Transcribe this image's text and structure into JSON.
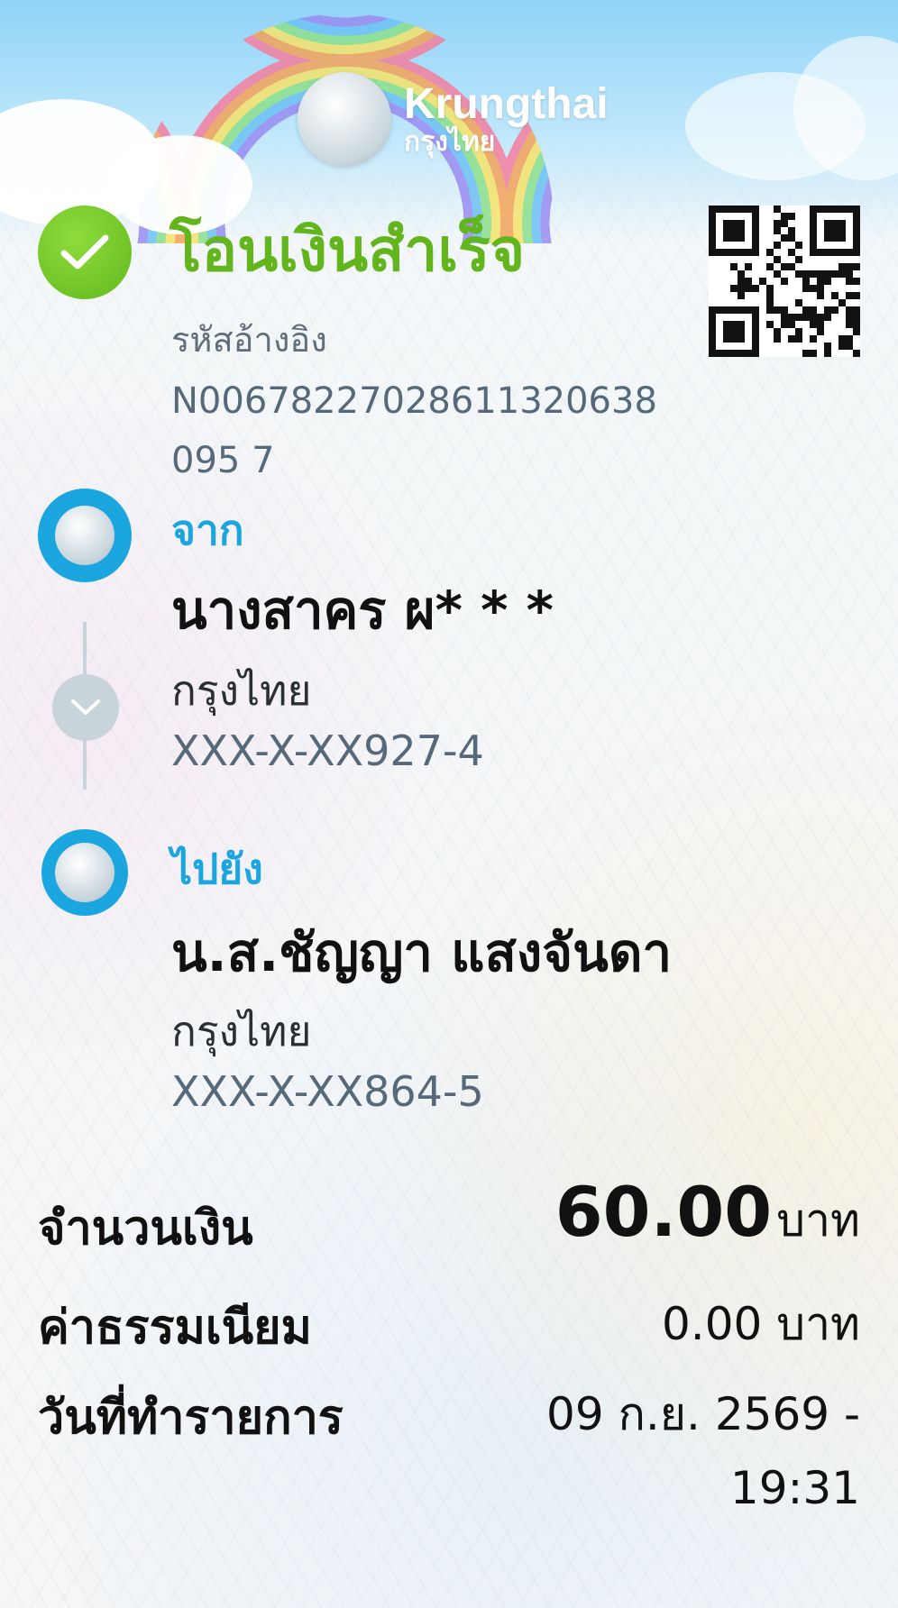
{
  "brand": {
    "name_en": "Krungthai",
    "name_th": "กรุงไทย"
  },
  "status": {
    "title": "โอนเงินสำเร็จ",
    "icon": "check-icon",
    "color": "#63b51e"
  },
  "reference": {
    "label": "รหัสอ้างอิง",
    "value": "N00678227028611320638095 7"
  },
  "from": {
    "label": "จาก",
    "name": "นางสาคร ผ* * *",
    "bank": "กรุงไทย",
    "account": "XXX-X-XX927-4"
  },
  "to": {
    "label": "ไปยัง",
    "name": "น.ส.ชัญญา แสงจันดา",
    "bank": "กรุงไทย",
    "account": "XXX-X-XX864-5"
  },
  "details": {
    "amount_label": "จำนวนเงิน",
    "amount_value": "60.00",
    "amount_unit": "บาท",
    "fee_label": "ค่าธรรมเนียม",
    "fee_value": "0.00 บาท",
    "date_label": "วันที่ทำรายการ",
    "date_value_line1": "09 ก.ย. 2569 -",
    "date_value_line2": "19:31"
  },
  "colors": {
    "accent_blue": "#1ba6e0",
    "text_gray": "#56697a"
  }
}
